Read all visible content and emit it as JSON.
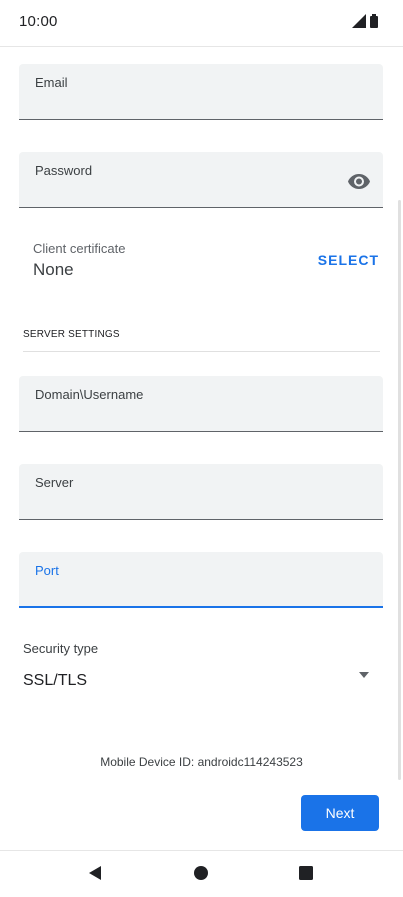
{
  "status_bar": {
    "time": "10:00"
  },
  "form": {
    "email": {
      "label": "Email",
      "value": ""
    },
    "password": {
      "label": "Password",
      "value": ""
    },
    "client_certificate": {
      "label": "Client certificate",
      "value": "None",
      "action": "SELECT"
    },
    "section_title": "SERVER SETTINGS",
    "domain_username": {
      "label": "Domain\\Username",
      "value": ""
    },
    "server": {
      "label": "Server",
      "value": ""
    },
    "port": {
      "label": "Port",
      "value": ""
    },
    "security_type": {
      "label": "Security type",
      "value": "SSL/TLS"
    }
  },
  "device_id_text": "Mobile Device ID: androidc114243523",
  "next_label": "Next",
  "icons": {
    "signal": "signal-icon",
    "battery": "battery-icon",
    "eye": "eye-icon",
    "dropdown": "dropdown-arrow-icon",
    "back": "back-icon",
    "home": "home-icon",
    "recent": "recent-apps-icon"
  },
  "colors": {
    "accent": "#1a73e8",
    "field_background": "#f1f3f4"
  }
}
